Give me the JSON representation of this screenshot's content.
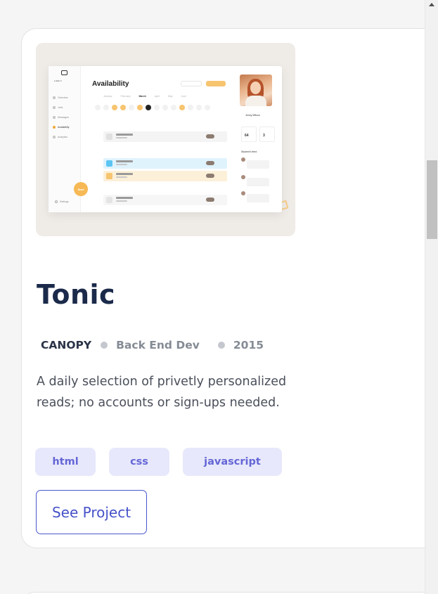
{
  "project": {
    "title": "Tonic",
    "client": "CANOPY",
    "role": "Back End Dev",
    "year": "2015",
    "description": "A daily selection of privetly personalized reads; no accounts or sign-ups needed.",
    "tags": [
      "html",
      "css",
      "javascript"
    ],
    "cta_label": "See Project"
  },
  "thumbnail": {
    "app_title": "Availability",
    "months": [
      "January",
      "February",
      "March",
      "April",
      "May",
      "June"
    ],
    "current_month": "March",
    "start_button": "Start",
    "profile_name": "Jenny Wilson",
    "stats": [
      "64",
      "3"
    ],
    "feed_title": "Student's feed",
    "nav_items": [
      "Overview",
      "Jobs",
      "Messages",
      "Availability",
      "Analytics"
    ],
    "active_nav": "Availability",
    "settings_label": "Settings"
  },
  "colors": {
    "title": "#1b2a4a",
    "accent": "#4b57cf",
    "tag_bg": "#e7e8fb",
    "thumbnail_bg": "#efebe7",
    "mock_highlight": "#f7c470"
  },
  "scrollbar": {
    "position_fraction": 0.27
  }
}
